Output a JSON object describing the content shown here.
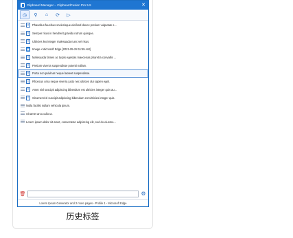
{
  "window": {
    "title": "Clipboard Manager – ClipboardFusion Pro 5.9",
    "close_glyph": "✕"
  },
  "toolbar": {
    "buttons": [
      {
        "icon": "clock-icon",
        "glyph": "◷"
      },
      {
        "icon": "pin-icon",
        "glyph": "⚲"
      },
      {
        "icon": "home-icon",
        "glyph": "⌂"
      },
      {
        "icon": "refresh-icon",
        "glyph": "⟳"
      },
      {
        "icon": "play-icon",
        "glyph": "▷"
      }
    ]
  },
  "items": [
    {
      "type": "T",
      "text": "Phasellus faucibus scelerisque eleifend donec pretium vulputate s..."
    },
    {
      "type": "T",
      "text": "Semper risus in hendrerit gravida rutrum quisque."
    },
    {
      "type": "T",
      "text": "Ultricies leo integer malesuada nunc vel risus."
    },
    {
      "type": "img",
      "text": "Image • Microsoft Edge [2021-05-28 11:55 AM]"
    },
    {
      "type": "T",
      "text": "Malesuada fames ac turpis egestas maecenas pharetra convallis ..."
    },
    {
      "type": "T",
      "text": "Pretium viverra suspendisse potenti nullam."
    },
    {
      "type": "T",
      "text": "Porta non pulvinar neque laoreet suspendisse."
    },
    {
      "type": "T",
      "text": "Rhoncus urna neque viverra justo nec ultrices dui sapien eget."
    },
    {
      "type": "T",
      "text": "Amet nisl suscipit adipiscing bibendum est ultricies integer quis au..."
    },
    {
      "type": "T",
      "text": "Sit amet nisl suscipit adipiscing bibendum est ultricies integer quis."
    },
    {
      "type": "none",
      "text": "Nulla facilisi nullam vehicula ipsum."
    },
    {
      "type": "none",
      "text": "Sit amet arcu odio ut."
    },
    {
      "type": "none",
      "text": "Lorem ipsum dolor sit amet, consectetur adipiscing elit, sed do eiusmo..."
    }
  ],
  "selected_index": 6,
  "search": {
    "value": "",
    "placeholder": ""
  },
  "bottom": {
    "trash_glyph": "🗑",
    "gear_glyph": "⚙"
  },
  "status_text": "Lorem Ipsum Generator and 2 more pages - Profile 1 - Microsoft Edge",
  "caption": "历史标签"
}
